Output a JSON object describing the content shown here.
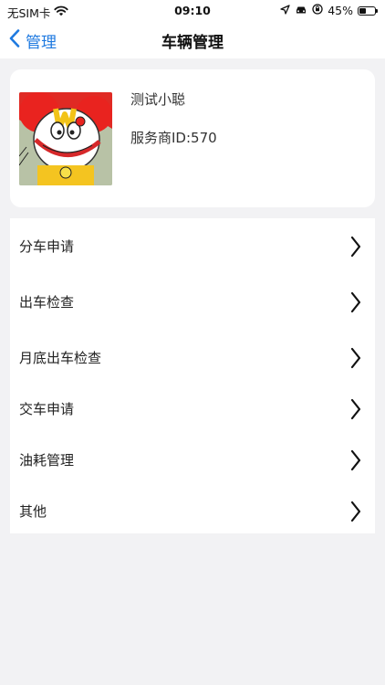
{
  "status_bar": {
    "carrier": "无SIM卡",
    "time": "09:10",
    "battery": "45%",
    "battery_level": 0.45,
    "icons": [
      "wifi-icon",
      "location-icon",
      "car-icon",
      "rotation-lock-icon",
      "battery-icon"
    ]
  },
  "nav": {
    "back_label": "管理",
    "title": "车辆管理",
    "accent": "#1f7ae0"
  },
  "profile": {
    "name": "测试小聪",
    "provider_id": "服务商ID:570"
  },
  "menu": {
    "items": [
      {
        "label": "分车申请"
      },
      {
        "label": "出车检查"
      },
      {
        "label": "月底出车检查"
      },
      {
        "label": "交车申请"
      },
      {
        "label": "油耗管理"
      },
      {
        "label": "其他"
      }
    ]
  }
}
